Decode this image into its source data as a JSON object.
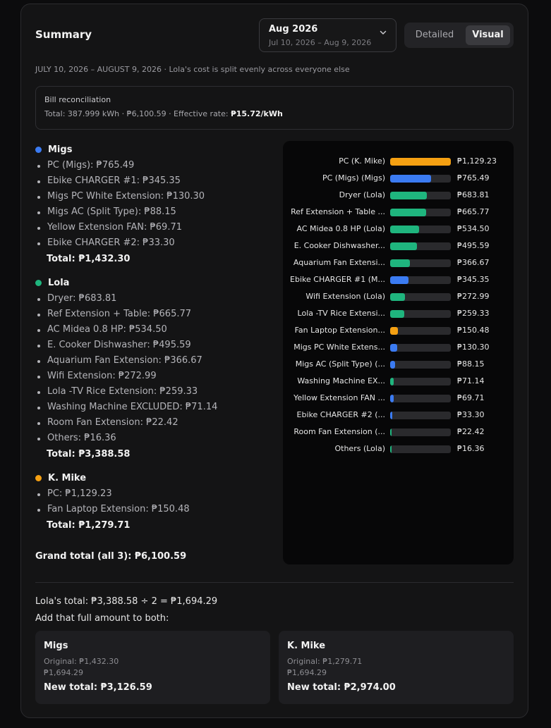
{
  "header": {
    "title": "Summary",
    "period": {
      "label": "Aug 2026",
      "range": "Jul 10, 2026 – Aug 9, 2026"
    },
    "view_toggle": {
      "detailed": "Detailed",
      "visual": "Visual",
      "selected": "Visual"
    }
  },
  "meta_line": "JULY 10, 2026 – AUGUST 9, 2026 · Lola's cost is split evenly across everyone else",
  "reconciliation": {
    "title": "Bill reconciliation",
    "line": "Total: 387.999 kWh · ₱6,100.59 · Effective rate: ",
    "rate": "₱15.72/kWh"
  },
  "people": [
    {
      "name": "Migs",
      "color": "#3b7bf2",
      "items": [
        "PC (Migs): ₱765.49",
        "Ebike CHARGER #1: ₱345.35",
        "Migs PC White Extension: ₱130.30",
        "Migs AC (Split Type): ₱88.15",
        "Yellow Extension FAN: ₱69.71",
        "Ebike CHARGER #2: ₱33.30"
      ],
      "total": "Total: ₱1,432.30"
    },
    {
      "name": "Lola",
      "color": "#1fb57e",
      "items": [
        "Dryer: ₱683.81",
        "Ref Extension + Table: ₱665.77",
        "AC Midea 0.8 HP: ₱534.50",
        "E. Cooker Dishwasher: ₱495.59",
        "Aquarium Fan Extension: ₱366.67",
        "Wifi Extension: ₱272.99",
        "Lola -TV Rice Extension: ₱259.33",
        "Washing Machine EXCLUDED: ₱71.14",
        "Room Fan Extension: ₱22.42",
        "Others: ₱16.36"
      ],
      "total": "Total: ₱3,388.58"
    },
    {
      "name": "K. Mike",
      "color": "#f5a012",
      "items": [
        "PC: ₱1,129.23",
        "Fan Laptop Extension: ₱150.48"
      ],
      "total": "Total: ₱1,279.71"
    }
  ],
  "grand_total": "Grand total (all 3): ₱6,100.59",
  "chart_data": {
    "type": "bar",
    "orientation": "horizontal",
    "max": 1129.23,
    "bars": [
      {
        "label": "PC (K. Mike)",
        "value": 1129.23,
        "value_label": "₱1,129.23",
        "color": "#f5a012"
      },
      {
        "label": "PC (Migs) (Migs)",
        "value": 765.49,
        "value_label": "₱765.49",
        "color": "#3b7bf2"
      },
      {
        "label": "Dryer (Lola)",
        "value": 683.81,
        "value_label": "₱683.81",
        "color": "#1fb57e"
      },
      {
        "label": "Ref Extension + Table ...",
        "value": 665.77,
        "value_label": "₱665.77",
        "color": "#1fb57e"
      },
      {
        "label": "AC Midea 0.8 HP (Lola)",
        "value": 534.5,
        "value_label": "₱534.50",
        "color": "#1fb57e"
      },
      {
        "label": "E. Cooker Dishwasher...",
        "value": 495.59,
        "value_label": "₱495.59",
        "color": "#1fb57e"
      },
      {
        "label": "Aquarium Fan Extensi...",
        "value": 366.67,
        "value_label": "₱366.67",
        "color": "#1fb57e"
      },
      {
        "label": "Ebike CHARGER #1 (M...",
        "value": 345.35,
        "value_label": "₱345.35",
        "color": "#3b7bf2"
      },
      {
        "label": "Wifi Extension (Lola)",
        "value": 272.99,
        "value_label": "₱272.99",
        "color": "#1fb57e"
      },
      {
        "label": "Lola -TV Rice Extensi...",
        "value": 259.33,
        "value_label": "₱259.33",
        "color": "#1fb57e"
      },
      {
        "label": "Fan Laptop Extension...",
        "value": 150.48,
        "value_label": "₱150.48",
        "color": "#f5a012"
      },
      {
        "label": "Migs PC White Extens...",
        "value": 130.3,
        "value_label": "₱130.30",
        "color": "#3b7bf2"
      },
      {
        "label": "Migs AC (Split Type) (...",
        "value": 88.15,
        "value_label": "₱88.15",
        "color": "#3b7bf2"
      },
      {
        "label": "Washing Machine EX...",
        "value": 71.14,
        "value_label": "₱71.14",
        "color": "#1fb57e"
      },
      {
        "label": "Yellow Extension FAN ...",
        "value": 69.71,
        "value_label": "₱69.71",
        "color": "#3b7bf2"
      },
      {
        "label": "Ebike CHARGER #2 (...",
        "value": 33.3,
        "value_label": "₱33.30",
        "color": "#3b7bf2"
      },
      {
        "label": "Room Fan Extension (...",
        "value": 22.42,
        "value_label": "₱22.42",
        "color": "#1fb57e"
      },
      {
        "label": "Others (Lola)",
        "value": 16.36,
        "value_label": "₱16.36",
        "color": "#1fb57e"
      }
    ]
  },
  "split": {
    "line1": "Lola's total: ₱3,388.58 ÷ 2 = ₱1,694.29",
    "line2": "Add that full amount to both:",
    "boxes": [
      {
        "name": "Migs",
        "original": "Original: ₱1,432.30",
        "added": "₱1,694.29",
        "new_total": "New total: ₱3,126.59"
      },
      {
        "name": "K. Mike",
        "original": "Original: ₱1,279.71",
        "added": "₱1,694.29",
        "new_total": "New total: ₱2,974.00"
      }
    ]
  }
}
